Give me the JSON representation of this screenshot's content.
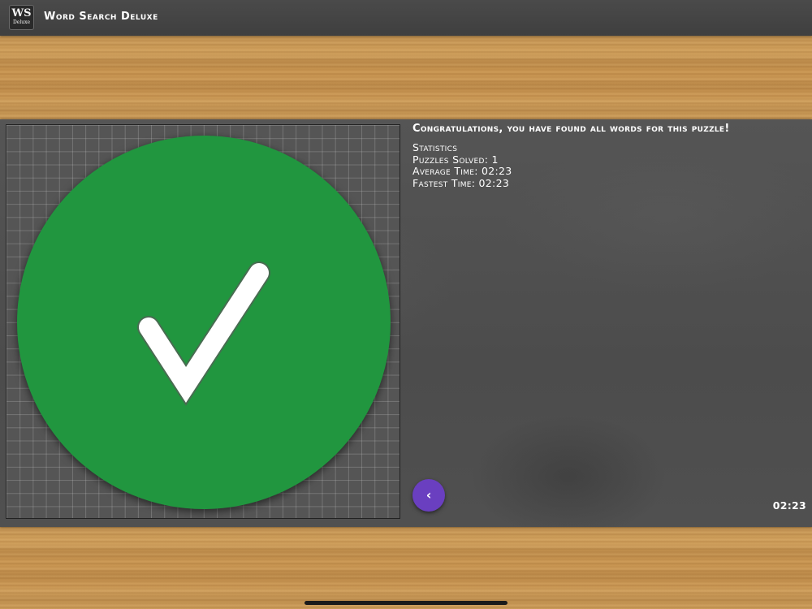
{
  "app": {
    "logo_big": "WS",
    "logo_small": "Deluxe",
    "title": "Word Search Deluxe"
  },
  "result": {
    "message": "Congratulations, you have found all words for this puzzle!",
    "icon": "checkmark-icon",
    "circle_color": "#21963f"
  },
  "stats": {
    "heading": "Statistics",
    "puzzles_solved": "Puzzles Solved: 1",
    "average_time": "Average Time: 02:23",
    "fastest_time": "Fastest Time: 02:23"
  },
  "controls": {
    "back_icon": "chevron-left-icon",
    "back_glyph": "‹",
    "back_color": "#6a3fc0"
  },
  "timer": "02:23"
}
